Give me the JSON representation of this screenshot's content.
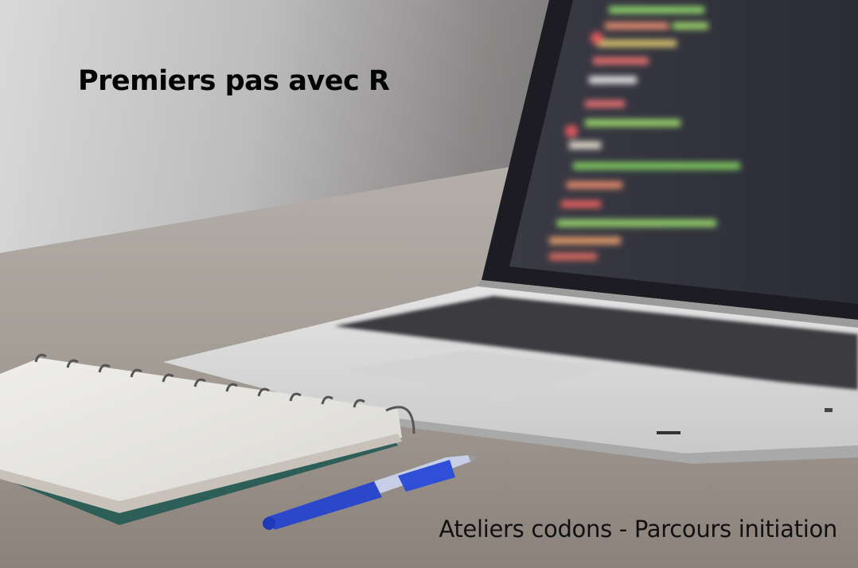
{
  "title": "Premiers pas avec R",
  "subtitle": "Ateliers codons - Parcours initiation"
}
